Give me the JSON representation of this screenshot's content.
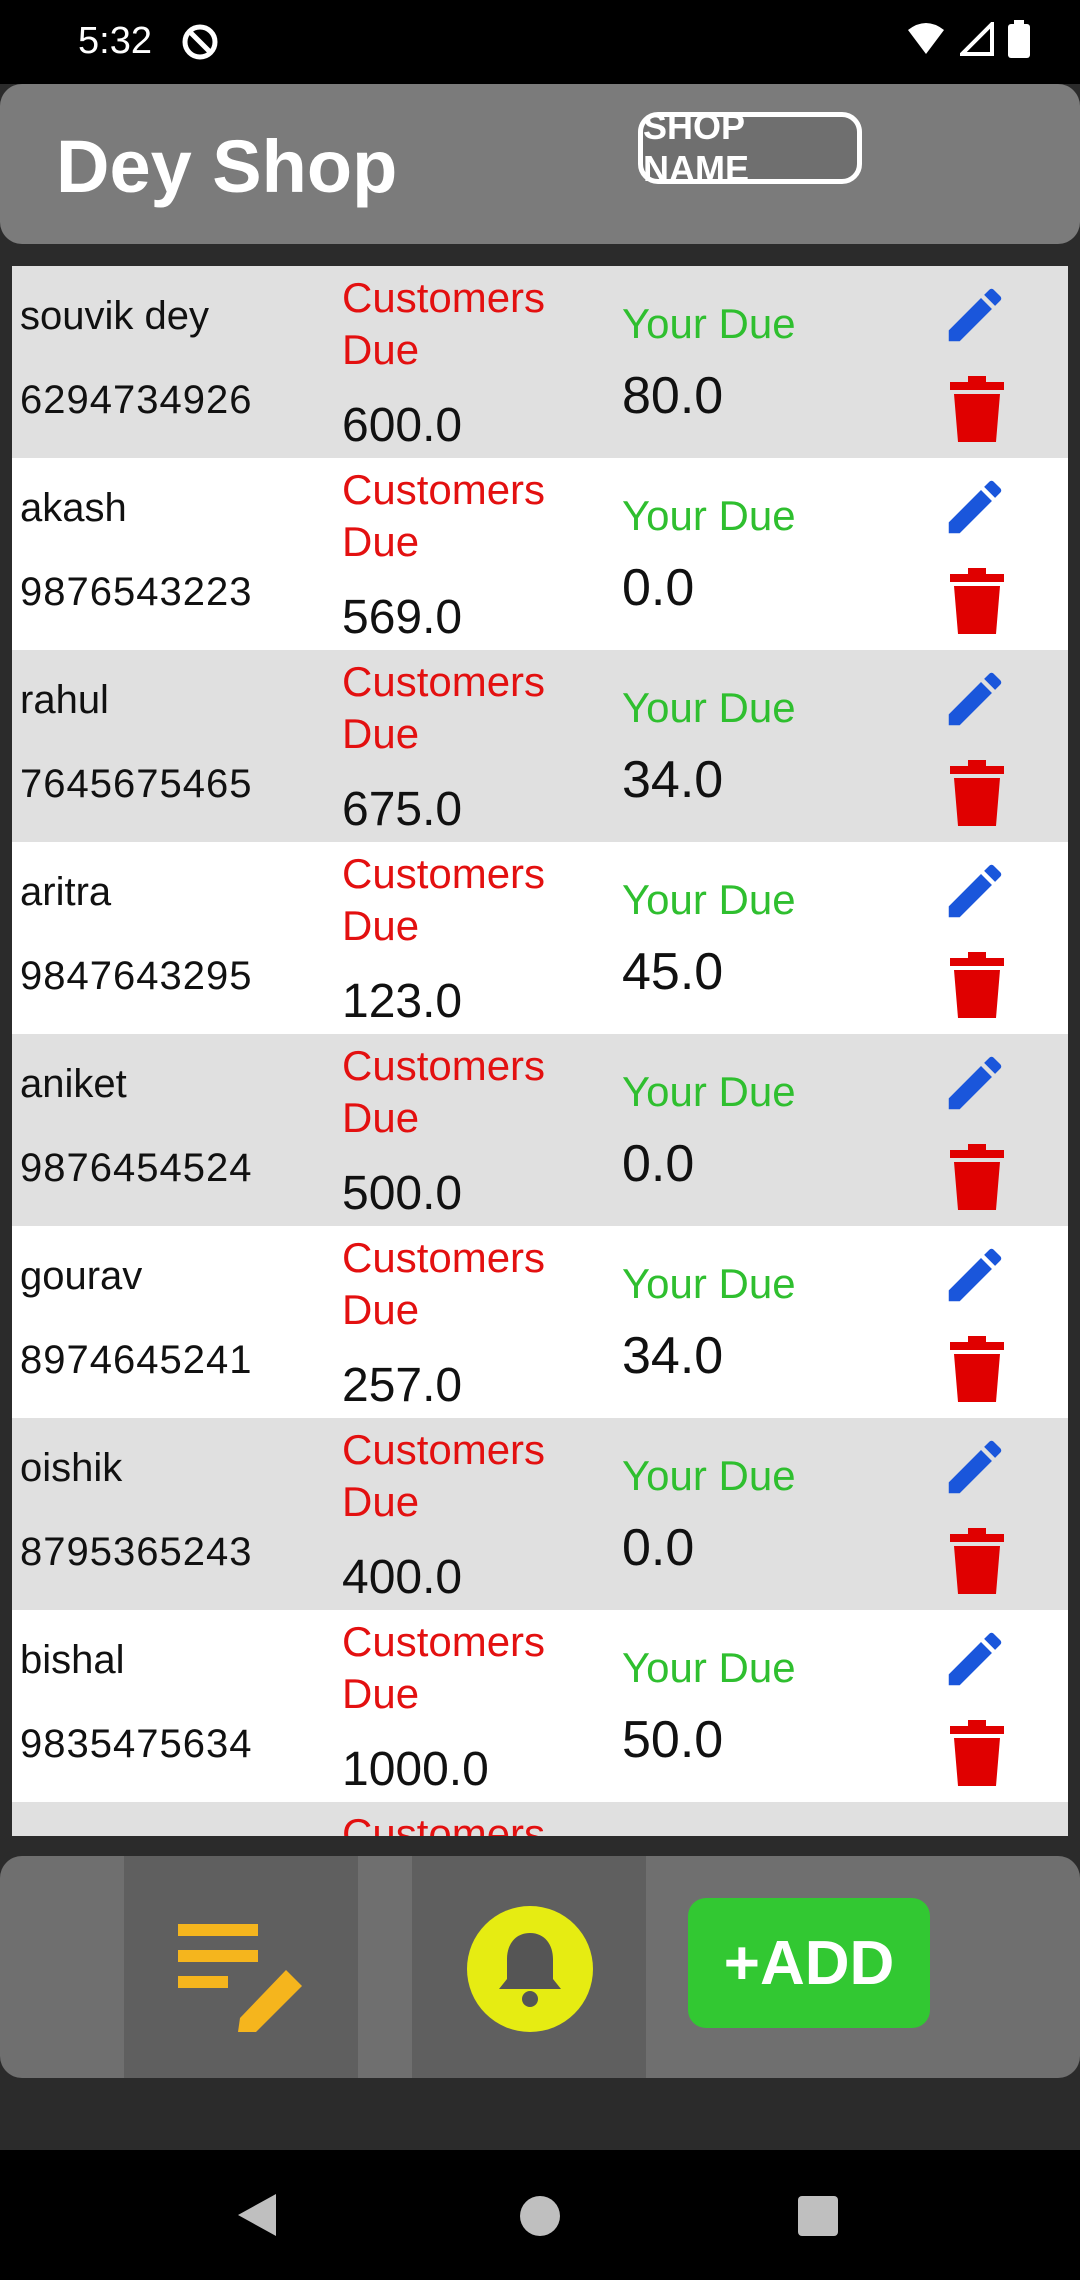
{
  "status_bar": {
    "time": "5:32"
  },
  "header": {
    "title": "Dey Shop",
    "shop_name_button": "SHOP NAME"
  },
  "list": {
    "customers_due_label": "Customers Due",
    "your_due_label": "Your Due",
    "rows": [
      {
        "name": "souvik dey",
        "phone": "6294734926",
        "customers_due": "600.0",
        "your_due": "80.0"
      },
      {
        "name": "akash",
        "phone": "9876543223",
        "customers_due": "569.0",
        "your_due": "0.0"
      },
      {
        "name": "rahul",
        "phone": "7645675465",
        "customers_due": "675.0",
        "your_due": "34.0"
      },
      {
        "name": "aritra",
        "phone": "9847643295",
        "customers_due": "123.0",
        "your_due": "45.0"
      },
      {
        "name": "aniket",
        "phone": "9876454524",
        "customers_due": "500.0",
        "your_due": "0.0"
      },
      {
        "name": "gourav",
        "phone": "8974645241",
        "customers_due": "257.0",
        "your_due": "34.0"
      },
      {
        "name": "oishik",
        "phone": "8795365243",
        "customers_due": "400.0",
        "your_due": "0.0"
      },
      {
        "name": "bishal",
        "phone": "9835475634",
        "customers_due": "1000.0",
        "your_due": "50.0"
      }
    ],
    "partial_label": "Customers"
  },
  "bottom_bar": {
    "add_button": "+ADD"
  },
  "colors": {
    "customers_due": "#e31010",
    "your_due": "#2fbf2f",
    "edit_icon": "#1a56db",
    "delete_icon": "#e00000",
    "add_button": "#32c832",
    "bell": "#e6ec12"
  }
}
